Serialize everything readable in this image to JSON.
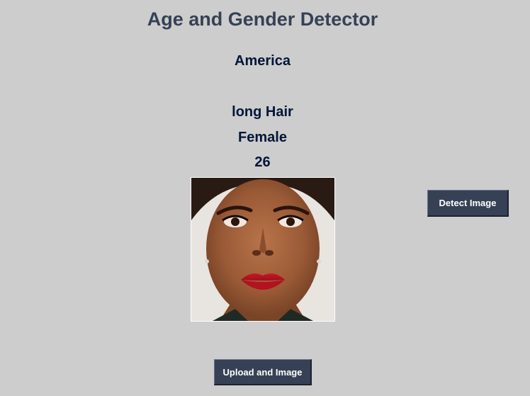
{
  "window": {
    "title": "Age and Gender Detector"
  },
  "results": {
    "country": "America",
    "hair": "long Hair",
    "gender": "Female",
    "age": "26"
  },
  "image": {
    "description_icon": "face-photo-icon"
  },
  "buttons": {
    "detect_label": "Detect Image",
    "upload_label": "Upload and Image"
  },
  "colors": {
    "background": "#cdcdcd",
    "title": "#364156",
    "result_text": "#011638",
    "button_bg": "#364156",
    "button_text": "#ffffff"
  }
}
